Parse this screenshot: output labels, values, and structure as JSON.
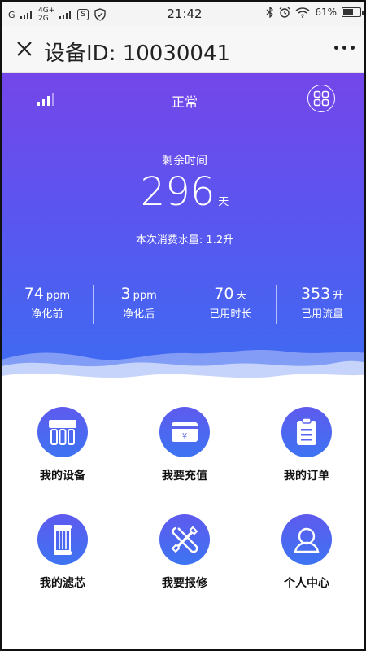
{
  "status_bar": {
    "carrier": "G",
    "net_top": "4G+",
    "net_bottom": "2G",
    "time": "21:42",
    "battery": "61%",
    "battery_fraction": 0.61
  },
  "nav": {
    "title": "设备ID: 10030041"
  },
  "hero": {
    "status": "正常",
    "remaining_label": "剩余时间",
    "remaining_value": "296",
    "remaining_unit": "天",
    "usage_text": "本次消费水量: 1.2升",
    "stats": [
      {
        "value": "74",
        "unit": "ppm",
        "label": "净化前"
      },
      {
        "value": "3",
        "unit": "ppm",
        "label": "净化后"
      },
      {
        "value": "70",
        "unit": "天",
        "label": "已用时长"
      },
      {
        "value": "353",
        "unit": "升",
        "label": "已用流量"
      }
    ]
  },
  "menu": {
    "items": [
      {
        "label": "我的设备",
        "icon": "purifier-icon"
      },
      {
        "label": "我要充值",
        "icon": "recharge-icon"
      },
      {
        "label": "我的订单",
        "icon": "clipboard-icon"
      },
      {
        "label": "我的滤芯",
        "icon": "filter-icon"
      },
      {
        "label": "我要报修",
        "icon": "tools-icon"
      },
      {
        "label": "个人中心",
        "icon": "user-icon"
      }
    ]
  },
  "colors": {
    "hero_top": "#7446e9",
    "hero_bottom": "#3c6cf2",
    "icon_circle": "#4d68f0"
  }
}
